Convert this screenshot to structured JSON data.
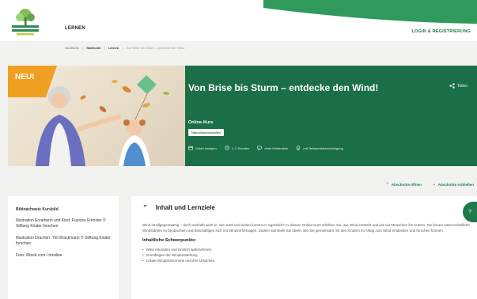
{
  "header": {
    "nav_learn": "LERNEN",
    "login": "LOGIN & REGISTRIERUNG",
    "brand_color": "#1e7a49"
  },
  "breadcrumb": {
    "items": [
      "Nordische",
      "Startseite",
      "Lernen",
      "Von Brise bis Sturm – entdecke den Wind"
    ]
  },
  "hero": {
    "badge": "NEU!",
    "title": "Von Brise bis Sturm – entdecke den Wind!",
    "share": "Teilen",
    "course_type": "Online-Kurs",
    "tag": "Naturwissenschaften",
    "meta": [
      {
        "icon": "calendar-icon",
        "text": "Sofort loslegen"
      },
      {
        "icon": "clock-icon",
        "text": "1–2 Stunden"
      },
      {
        "icon": "chat-icon",
        "text": "ohne Moderation"
      },
      {
        "icon": "certificate-icon",
        "text": "mit Teilnahmebescheinigung"
      }
    ]
  },
  "expand": {
    "open_all": "Abschnitte öffnen",
    "close_all": "Abschnitte schließen"
  },
  "sidebar": {
    "heading": "Bildnachweis Kursbild",
    "paragraphs": [
      "Illustration Erzieherin und Kind: Frances Frenster © Stiftung Kinder forschen",
      "Illustration Drachen: Tim Brackmann © Stiftung Kinder forschen",
      "Foto: iStock.com / torsilwe"
    ]
  },
  "main": {
    "section_title": "Inhalt und Lernziele",
    "intro": "Wind ist allgegenwärtig – doch weshalb weht er, wie stark und woher kommt er eigentlich? In diesem Online-Kurs erfahren Sie, wie Wind entsteht und wie wir Menschen ihn nutzen. Sie lernen unterschiedliche Windstärken zu beobachten und beschäftigen sich mit Windvorhersagen. Zudem sammeln Sie Ideen, wie Sie gemeinsam mit den Kindern im Alltag zum Wind entdecken und forschen können.",
    "sub_heading": "Inhaltliche Schwerpunkte:",
    "list": [
      "Wind erkunden und sinnlich wahrnehmen",
      "Grundlagen der Windentstehung",
      "Lokale Windphänomene und ihre Ursachen"
    ]
  }
}
